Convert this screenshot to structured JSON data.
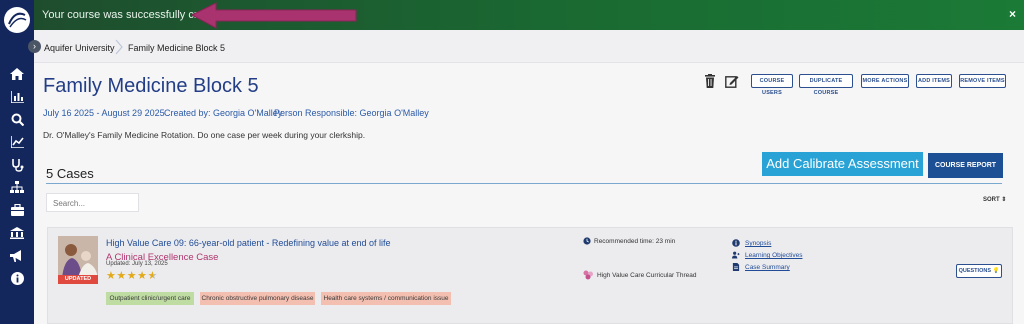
{
  "banner": {
    "message": "Your course was successfully created.",
    "close": "×"
  },
  "breadcrumb": {
    "items": [
      "Aquifer University",
      "Family Medicine Block 5"
    ]
  },
  "sidebar": {
    "items": [
      "home-icon",
      "reports-icon",
      "search-icon",
      "analytics-icon",
      "stethoscope-icon",
      "hierarchy-icon",
      "briefcase-icon",
      "institution-icon",
      "announcements-icon",
      "info-icon"
    ]
  },
  "course": {
    "title": "Family Medicine Block 5",
    "dates": "July 16 2025 -  August 29 2025",
    "created_by": "Created by: Georgia O'Malley",
    "responsible": "Person Responsible: Georgia O'Malley",
    "description": "Dr. O'Malley's Family Medicine Rotation. Do one case per week during your clerkship."
  },
  "toolbar": {
    "course_users": "COURSE USERS",
    "duplicate_course": "DUPLICATE COURSE",
    "more_actions": "MORE ACTIONS",
    "add_items": "ADD ITEMS",
    "remove_items": "REMOVE ITEMS"
  },
  "cases_section": {
    "title": "5 Cases",
    "add_calibrate": "Add Calibrate Assessment",
    "course_report": "COURSE REPORT",
    "search_placeholder": "Search...",
    "sort_label": "SORT"
  },
  "case": {
    "title": "High Value Care 09: 66-year-old patient - Redefining value at end of life",
    "subtitle": "A Clinical Excellence Case",
    "updated": "Updated: July 13, 2025",
    "badge": "UPDATED",
    "stars": "★★★★★",
    "rating": 4.5,
    "tags": [
      "Outpatient clinic/urgent care",
      "Chronic obstructive pulmonary disease",
      "Health care systems / communication issue"
    ],
    "recommended_time": "Recommended time: 23 min",
    "thread": "High Value Care Curricular Thread",
    "links": [
      "Synopsis",
      "Learning Objectives",
      "Case Summary"
    ],
    "questions": "QUESTIONS"
  },
  "colors": {
    "sidebar": "#13275d",
    "banner": "#1b6a32",
    "annotation_arrow": "#a8336e",
    "accent": "#29a3d6",
    "primary": "#1d4f94"
  }
}
